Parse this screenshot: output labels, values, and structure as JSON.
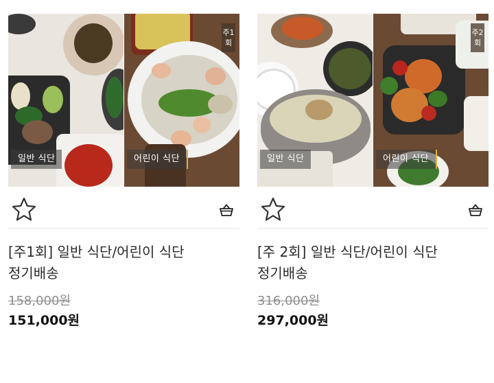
{
  "products": [
    {
      "image_labels": {
        "left": "일반 식단",
        "right": "어린이 식단",
        "week_badge": "주1회"
      },
      "title": "[주1회] 일반 식단/어린이 식단 정기배송",
      "original_price": "158,000원",
      "sale_price": "151,000원",
      "icons": {
        "wishlist": "star-outline-icon",
        "cart": "basket-icon"
      }
    },
    {
      "image_labels": {
        "left": "일반 식단",
        "right": "어린이 식단",
        "week_badge": "주2회"
      },
      "title": "[주 2회] 일반 식단/어린이 식단 정기배송",
      "original_price": "316,000원",
      "sale_price": "297,000원",
      "icons": {
        "wishlist": "star-outline-icon",
        "cart": "basket-icon"
      }
    }
  ],
  "colors": {
    "tag_accent": "#e0b23a",
    "divider": "#e4e4e4",
    "strike_price": "#8d8d8d"
  }
}
